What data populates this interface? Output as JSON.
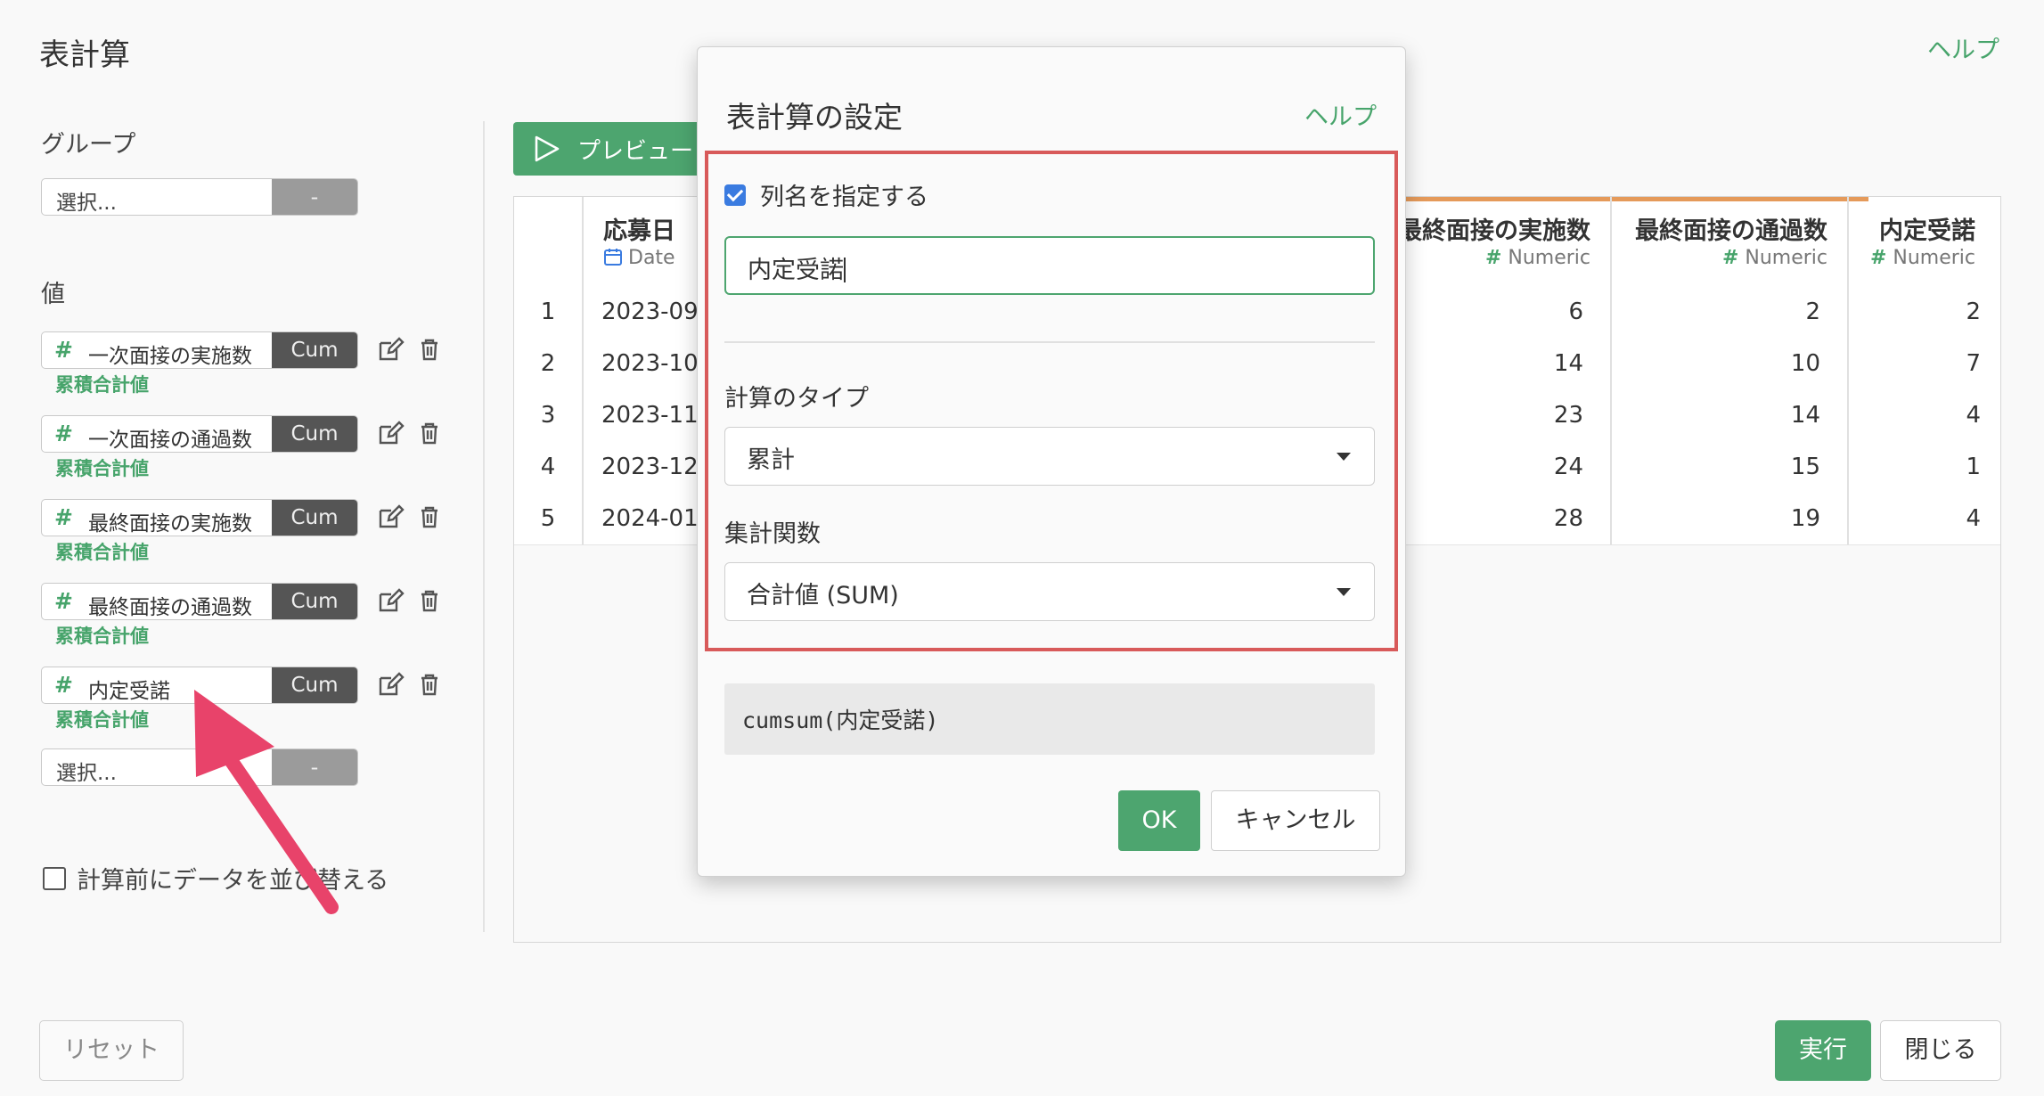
{
  "page": {
    "title": "表計算",
    "help": "ヘルプ"
  },
  "sidebar": {
    "group_label": "グループ",
    "group_select_placeholder": "選択...",
    "group_select_button": "-",
    "values_label": "値",
    "values": [
      {
        "name": "一次面接の実施数",
        "func": "Cum",
        "sub": "累積合計値"
      },
      {
        "name": "一次面接の通過数",
        "func": "Cum",
        "sub": "累積合計値"
      },
      {
        "name": "最終面接の実施数",
        "func": "Cum",
        "sub": "累積合計値"
      },
      {
        "name": "最終面接の通過数",
        "func": "Cum",
        "sub": "累積合計値"
      },
      {
        "name": "内定受諾",
        "func": "Cum",
        "sub": "累積合計値"
      }
    ],
    "value_select_placeholder": "選択...",
    "value_select_button": "-",
    "sort_checkbox_label": "計算前にデータを並び替える",
    "hash": "#"
  },
  "preview": {
    "label": "プレビュー"
  },
  "table": {
    "columns": [
      {
        "name": "応募日",
        "type": "Date"
      },
      {
        "name": "最終面接の実施数",
        "type": "Numeric"
      },
      {
        "name": "最終面接の通過数",
        "type": "Numeric"
      },
      {
        "name": "内定受諾",
        "type": "Numeric"
      }
    ],
    "rows": [
      {
        "n": "1",
        "date": "2023-09",
        "a": "6",
        "b": "2",
        "c": "2"
      },
      {
        "n": "2",
        "date": "2023-10",
        "a": "14",
        "b": "10",
        "c": "7"
      },
      {
        "n": "3",
        "date": "2023-11",
        "a": "23",
        "b": "14",
        "c": "4"
      },
      {
        "n": "4",
        "date": "2023-12",
        "a": "24",
        "b": "15",
        "c": "1"
      },
      {
        "n": "5",
        "date": "2024-01",
        "a": "28",
        "b": "19",
        "c": "4"
      }
    ]
  },
  "footer": {
    "reset": "リセット",
    "run": "実行",
    "close": "閉じる"
  },
  "modal": {
    "title": "表計算の設定",
    "help": "ヘルプ",
    "checkbox_label": "列名を指定する",
    "checkbox_checked": true,
    "column_name_value": "内定受諾",
    "calc_type_label": "計算のタイプ",
    "calc_type_value": "累計",
    "agg_label": "集計関数",
    "agg_value": "合計値 (SUM)",
    "formula": "cumsum(内定受諾)",
    "ok": "OK",
    "cancel": "キャンセル"
  },
  "colors": {
    "accent": "#4da56f",
    "highlight_border": "#d85a5a",
    "arrow": "#e8436a"
  }
}
